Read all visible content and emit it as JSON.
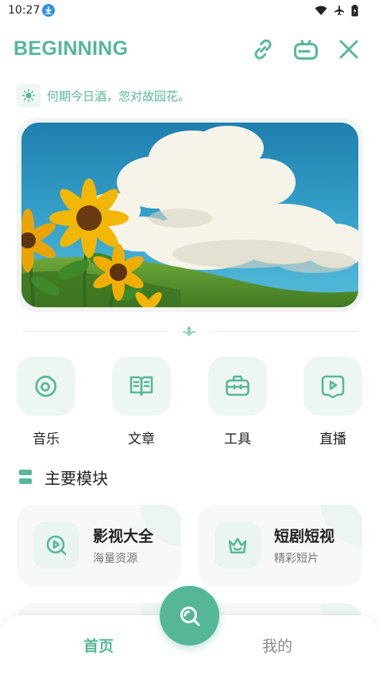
{
  "status_bar": {
    "time": "10:27"
  },
  "header": {
    "title": "BEGINNING",
    "link_icon": "link-icon",
    "robot_icon": "robot-icon",
    "close_icon": "close-icon"
  },
  "quote": {
    "icon": "sun-icon",
    "text": "何期今日酒，忽对故园花。"
  },
  "banner": {
    "alt_icon": "banner-image"
  },
  "quick_nav": [
    {
      "label": "音乐",
      "icon": "music-disc-icon"
    },
    {
      "label": "文章",
      "icon": "book-icon"
    },
    {
      "label": "工具",
      "icon": "toolbox-icon"
    },
    {
      "label": "直播",
      "icon": "live-tv-icon"
    }
  ],
  "section": {
    "title": "主要模块"
  },
  "modules": [
    {
      "title": "影视大全",
      "subtitle": "海量资源",
      "icon": "video-search-icon"
    },
    {
      "title": "短剧短视",
      "subtitle": "精彩短片",
      "icon": "crown-icon"
    }
  ],
  "bottom_nav": {
    "tabs": [
      {
        "label": "首页",
        "active": true
      },
      {
        "label": "我的",
        "active": false
      }
    ],
    "fab_icon": "search-icon"
  },
  "colors": {
    "accent": "#55b798",
    "tile_bg": "#eef6f2",
    "inactive": "#8a8a8a"
  }
}
